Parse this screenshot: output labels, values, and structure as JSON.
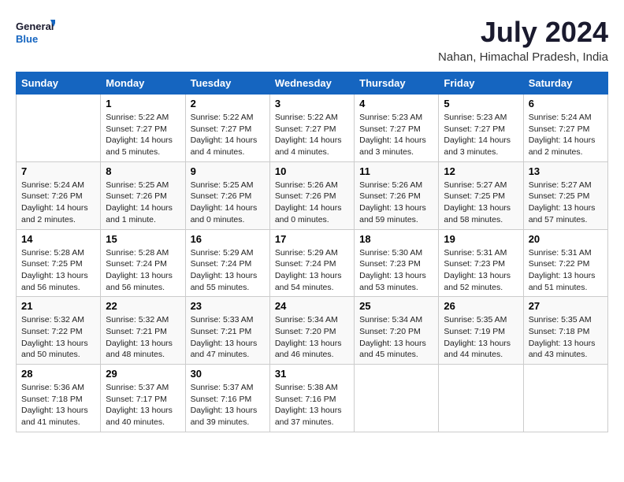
{
  "logo": {
    "line1": "General",
    "line2": "Blue"
  },
  "title": "July 2024",
  "location": "Nahan, Himachal Pradesh, India",
  "weekdays": [
    "Sunday",
    "Monday",
    "Tuesday",
    "Wednesday",
    "Thursday",
    "Friday",
    "Saturday"
  ],
  "weeks": [
    [
      {
        "day": "",
        "info": ""
      },
      {
        "day": "1",
        "info": "Sunrise: 5:22 AM\nSunset: 7:27 PM\nDaylight: 14 hours\nand 5 minutes."
      },
      {
        "day": "2",
        "info": "Sunrise: 5:22 AM\nSunset: 7:27 PM\nDaylight: 14 hours\nand 4 minutes."
      },
      {
        "day": "3",
        "info": "Sunrise: 5:22 AM\nSunset: 7:27 PM\nDaylight: 14 hours\nand 4 minutes."
      },
      {
        "day": "4",
        "info": "Sunrise: 5:23 AM\nSunset: 7:27 PM\nDaylight: 14 hours\nand 3 minutes."
      },
      {
        "day": "5",
        "info": "Sunrise: 5:23 AM\nSunset: 7:27 PM\nDaylight: 14 hours\nand 3 minutes."
      },
      {
        "day": "6",
        "info": "Sunrise: 5:24 AM\nSunset: 7:27 PM\nDaylight: 14 hours\nand 2 minutes."
      }
    ],
    [
      {
        "day": "7",
        "info": "Sunrise: 5:24 AM\nSunset: 7:26 PM\nDaylight: 14 hours\nand 2 minutes."
      },
      {
        "day": "8",
        "info": "Sunrise: 5:25 AM\nSunset: 7:26 PM\nDaylight: 14 hours\nand 1 minute."
      },
      {
        "day": "9",
        "info": "Sunrise: 5:25 AM\nSunset: 7:26 PM\nDaylight: 14 hours\nand 0 minutes."
      },
      {
        "day": "10",
        "info": "Sunrise: 5:26 AM\nSunset: 7:26 PM\nDaylight: 14 hours\nand 0 minutes."
      },
      {
        "day": "11",
        "info": "Sunrise: 5:26 AM\nSunset: 7:26 PM\nDaylight: 13 hours\nand 59 minutes."
      },
      {
        "day": "12",
        "info": "Sunrise: 5:27 AM\nSunset: 7:25 PM\nDaylight: 13 hours\nand 58 minutes."
      },
      {
        "day": "13",
        "info": "Sunrise: 5:27 AM\nSunset: 7:25 PM\nDaylight: 13 hours\nand 57 minutes."
      }
    ],
    [
      {
        "day": "14",
        "info": "Sunrise: 5:28 AM\nSunset: 7:25 PM\nDaylight: 13 hours\nand 56 minutes."
      },
      {
        "day": "15",
        "info": "Sunrise: 5:28 AM\nSunset: 7:24 PM\nDaylight: 13 hours\nand 56 minutes."
      },
      {
        "day": "16",
        "info": "Sunrise: 5:29 AM\nSunset: 7:24 PM\nDaylight: 13 hours\nand 55 minutes."
      },
      {
        "day": "17",
        "info": "Sunrise: 5:29 AM\nSunset: 7:24 PM\nDaylight: 13 hours\nand 54 minutes."
      },
      {
        "day": "18",
        "info": "Sunrise: 5:30 AM\nSunset: 7:23 PM\nDaylight: 13 hours\nand 53 minutes."
      },
      {
        "day": "19",
        "info": "Sunrise: 5:31 AM\nSunset: 7:23 PM\nDaylight: 13 hours\nand 52 minutes."
      },
      {
        "day": "20",
        "info": "Sunrise: 5:31 AM\nSunset: 7:22 PM\nDaylight: 13 hours\nand 51 minutes."
      }
    ],
    [
      {
        "day": "21",
        "info": "Sunrise: 5:32 AM\nSunset: 7:22 PM\nDaylight: 13 hours\nand 50 minutes."
      },
      {
        "day": "22",
        "info": "Sunrise: 5:32 AM\nSunset: 7:21 PM\nDaylight: 13 hours\nand 48 minutes."
      },
      {
        "day": "23",
        "info": "Sunrise: 5:33 AM\nSunset: 7:21 PM\nDaylight: 13 hours\nand 47 minutes."
      },
      {
        "day": "24",
        "info": "Sunrise: 5:34 AM\nSunset: 7:20 PM\nDaylight: 13 hours\nand 46 minutes."
      },
      {
        "day": "25",
        "info": "Sunrise: 5:34 AM\nSunset: 7:20 PM\nDaylight: 13 hours\nand 45 minutes."
      },
      {
        "day": "26",
        "info": "Sunrise: 5:35 AM\nSunset: 7:19 PM\nDaylight: 13 hours\nand 44 minutes."
      },
      {
        "day": "27",
        "info": "Sunrise: 5:35 AM\nSunset: 7:18 PM\nDaylight: 13 hours\nand 43 minutes."
      }
    ],
    [
      {
        "day": "28",
        "info": "Sunrise: 5:36 AM\nSunset: 7:18 PM\nDaylight: 13 hours\nand 41 minutes."
      },
      {
        "day": "29",
        "info": "Sunrise: 5:37 AM\nSunset: 7:17 PM\nDaylight: 13 hours\nand 40 minutes."
      },
      {
        "day": "30",
        "info": "Sunrise: 5:37 AM\nSunset: 7:16 PM\nDaylight: 13 hours\nand 39 minutes."
      },
      {
        "day": "31",
        "info": "Sunrise: 5:38 AM\nSunset: 7:16 PM\nDaylight: 13 hours\nand 37 minutes."
      },
      {
        "day": "",
        "info": ""
      },
      {
        "day": "",
        "info": ""
      },
      {
        "day": "",
        "info": ""
      }
    ]
  ]
}
